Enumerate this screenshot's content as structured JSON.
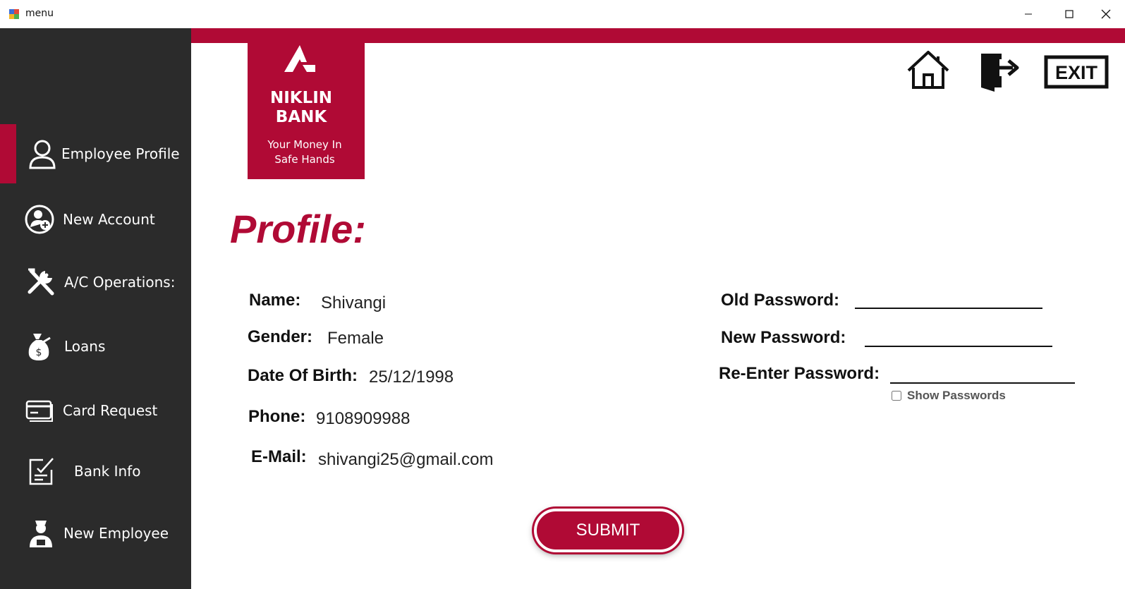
{
  "window": {
    "title": "menu",
    "min_icon": "minimize-icon",
    "max_icon": "maximize-icon",
    "close_icon": "close-icon"
  },
  "brand": {
    "name": "NIKLIN\nBANK",
    "tagline": "Your Money In\nSafe Hands",
    "accent": "#b00a35",
    "sidebar_bg": "#2b2b2b"
  },
  "sidebar": {
    "items": [
      {
        "label": "Employee Profile",
        "icon": "user-icon",
        "active": true
      },
      {
        "label": "New Account",
        "icon": "add-user-icon",
        "active": false
      },
      {
        "label": "A/C Operations:",
        "icon": "tools-icon",
        "active": false
      },
      {
        "label": "Loans",
        "icon": "money-bag-icon",
        "active": false
      },
      {
        "label": "Card Request",
        "icon": "card-icon",
        "active": false
      },
      {
        "label": "Bank Info",
        "icon": "checklist-icon",
        "active": false
      },
      {
        "label": "New Employee",
        "icon": "employee-icon",
        "active": false
      }
    ]
  },
  "toolbar": {
    "home_icon": "home-icon",
    "logout_icon": "logout-icon",
    "exit_label": "EXIT"
  },
  "profile": {
    "title": "Profile:",
    "name_label": "Name:",
    "name": "Shivangi",
    "gender_label": "Gender:",
    "gender": "Female",
    "dob_label": "Date Of Birth:",
    "dob": "25/12/1998",
    "phone_label": "Phone:",
    "phone": "9108909988",
    "email_label": "E-Mail:",
    "email": "shivangi25@gmail.com"
  },
  "password": {
    "old_label": "Old Password:",
    "old_value": "",
    "new_label": "New Password:",
    "new_value": "",
    "reenter_label": "Re-Enter Password:",
    "reenter_value": "",
    "show_label": "Show Passwords",
    "show_checked": false
  },
  "submit": {
    "label": "SUBMIT"
  }
}
